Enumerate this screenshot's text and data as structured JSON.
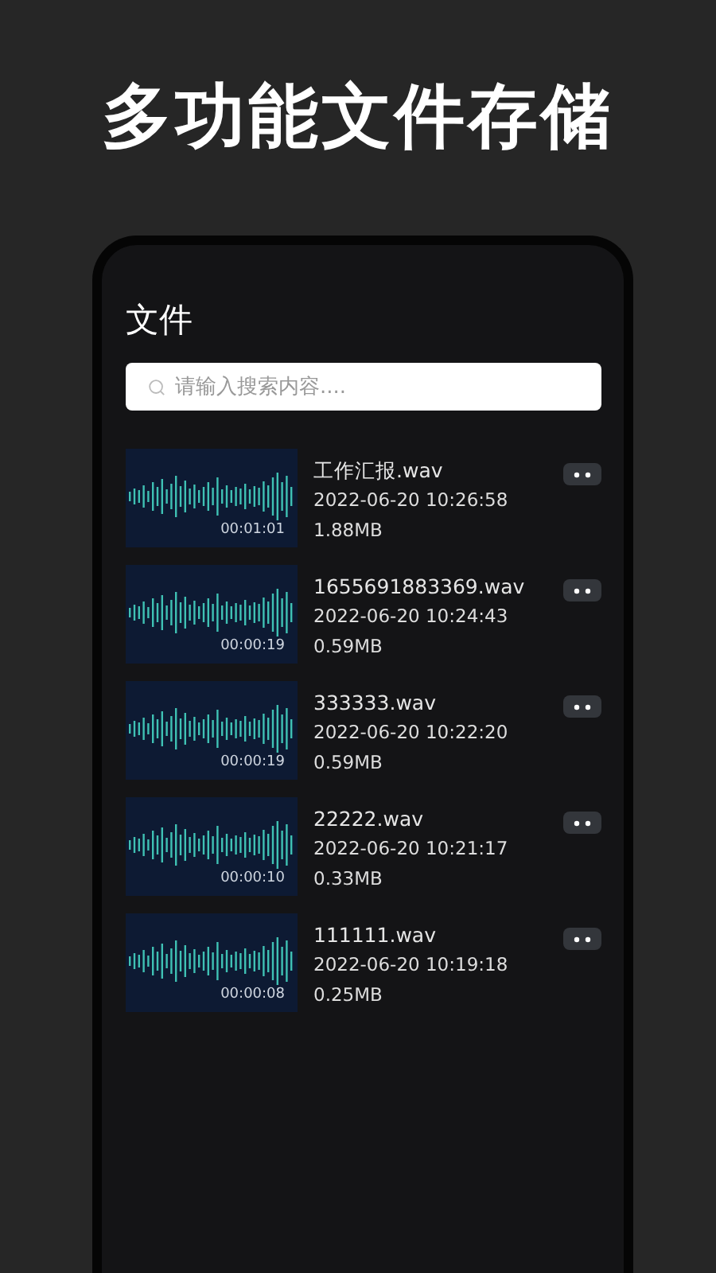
{
  "headline": "多功能文件存储",
  "screen": {
    "title": "文件",
    "search": {
      "placeholder": "请输入搜索内容...."
    },
    "files": [
      {
        "name": "工作汇报.wav",
        "date": "2022-06-20 10:26:58",
        "size": "1.88MB",
        "duration": "00:01:01"
      },
      {
        "name": "1655691883369.wav",
        "date": "2022-06-20 10:24:43",
        "size": "0.59MB",
        "duration": "00:00:19"
      },
      {
        "name": "333333.wav",
        "date": "2022-06-20 10:22:20",
        "size": "0.59MB",
        "duration": "00:00:19"
      },
      {
        "name": "22222.wav",
        "date": "2022-06-20 10:21:17",
        "size": "0.33MB",
        "duration": "00:00:10"
      },
      {
        "name": "111111.wav",
        "date": "2022-06-20 10:19:18",
        "size": "0.25MB",
        "duration": "00:00:08"
      }
    ]
  }
}
